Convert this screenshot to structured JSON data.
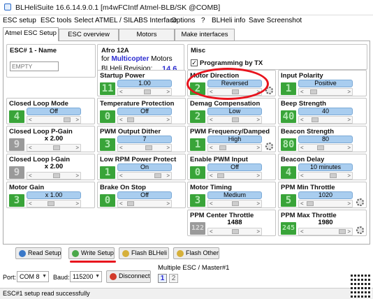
{
  "window": {
    "title": "BLHeliSuite 16.6.14.9.0.1  [m4wFCIntf Atmel-BLB/SK @COMB]"
  },
  "menu": [
    "ESC setup",
    "ESC tools",
    "Select ATMEL / SILABS Interface",
    "Options",
    "?",
    "BLHeli info",
    "Save Screenshot"
  ],
  "tabs": [
    "Atmel ESC Setup",
    "ESC overview",
    "Motors",
    "Make interfaces"
  ],
  "esc": {
    "name_label": "ESC# 1 - Name",
    "name_value": "EMPTY",
    "model": "Afro 12A",
    "for_word": "for",
    "multicopter": "Multicopter",
    "motors_word": "Motors",
    "revision_label": "BLHeli Revision:",
    "revision": "14.6"
  },
  "misc": {
    "title": "Misc",
    "checkbox_label": "Programming by TX",
    "checked": true
  },
  "settings": [
    {
      "id": "startup-power",
      "label": "Startup Power",
      "num": "11",
      "value": "1.00",
      "level": 0.55,
      "grey": false
    },
    {
      "id": "motor-direction",
      "label": "Motor Direction",
      "num": "2",
      "value": "Reversed",
      "level": 0.5,
      "grey": false
    },
    {
      "id": "input-polarity",
      "label": "Input Polarity",
      "num": "1",
      "value": "Positive",
      "level": 0.15,
      "grey": false
    },
    {
      "id": "closed-loop-mode",
      "label": "Closed Loop Mode",
      "num": "4",
      "value": "Off",
      "level": 0.85,
      "grey": false
    },
    {
      "id": "temperature-protection",
      "label": "Temperature Protection",
      "num": "0",
      "value": "Off",
      "level": 0.1,
      "grey": false
    },
    {
      "id": "demag-compensation",
      "label": "Demag Compensation",
      "num": "2",
      "value": "Low",
      "level": 0.5,
      "grey": false
    },
    {
      "id": "beep-strength",
      "label": "Beep Strength",
      "num": "40",
      "value": "40",
      "level": 0.2,
      "grey": false
    },
    {
      "id": "closed-loop-p-gain",
      "label": "Closed Loop P-Gain",
      "num": "9",
      "value": "x 2.00",
      "level": 0.55,
      "grey": true
    },
    {
      "id": "pwm-output-dither",
      "label": "PWM Output Dither",
      "num": "3",
      "value": "7",
      "level": 0.6,
      "grey": false
    },
    {
      "id": "pwm-frequency-damped",
      "label": "PWM Frequency/Damped",
      "num": "1",
      "value": "High",
      "level": 0.15,
      "grey": false
    },
    {
      "id": "beacon-strength",
      "label": "Beacon Strength",
      "num": "80",
      "value": "80",
      "level": 0.35,
      "grey": false
    },
    {
      "id": "closed-loop-i-gain",
      "label": "Closed Loop I-Gain",
      "num": "9",
      "value": "x 2.00",
      "level": 0.55,
      "grey": true
    },
    {
      "id": "low-rpm-power-protect",
      "label": "Low RPM Power Protect",
      "num": "1",
      "value": "On",
      "level": 0.85,
      "grey": false
    },
    {
      "id": "enable-pwm-input",
      "label": "Enable PWM Input",
      "num": "0",
      "value": "Off",
      "level": 0.1,
      "grey": false
    },
    {
      "id": "beacon-delay",
      "label": "Beacon Delay",
      "num": "4",
      "value": "10 minutes",
      "level": 0.7,
      "grey": false
    },
    {
      "id": "motor-gain",
      "label": "Motor Gain",
      "num": "3",
      "value": "x 1.00",
      "level": 0.4,
      "grey": false
    },
    {
      "id": "brake-on-stop",
      "label": "Brake On Stop",
      "num": "0",
      "value": "Off",
      "level": 0.1,
      "grey": false
    },
    {
      "id": "motor-timing",
      "label": "Motor Timing",
      "num": "3",
      "value": "Medium",
      "level": 0.5,
      "grey": false
    },
    {
      "id": "ppm-min-throttle",
      "label": "PPM Min Throttle",
      "num": "5",
      "value": "1020",
      "level": 0.05,
      "grey": false
    },
    {
      "id": "ppm-center-throttle",
      "label": "PPM Center Throttle",
      "num": "122",
      "value": "1488",
      "level": 0.5,
      "grey": true
    },
    {
      "id": "ppm-max-throttle",
      "label": "PPM Max Throttle",
      "num": "245",
      "value": "1980",
      "level": 0.95,
      "grey": false
    }
  ],
  "buttons": {
    "read": "Read Setup",
    "write": "Write Setup",
    "flash_blheli": "Flash BLHeli",
    "flash_other": "Flash Other"
  },
  "port": {
    "port_label": "Port:",
    "port_value": "COM 8",
    "baud_label": "Baud:",
    "baud_value": "115200",
    "disconnect": "Disconnect"
  },
  "multi": {
    "title": "Multiple ESC / Master#1",
    "esc1": "1",
    "esc2": "2"
  },
  "status": {
    "text": "ESC#1 setup read successfully"
  },
  "colors": {
    "accent": "#39a439",
    "value_bg": "#a9cdef",
    "annotation": "#e8131d"
  }
}
